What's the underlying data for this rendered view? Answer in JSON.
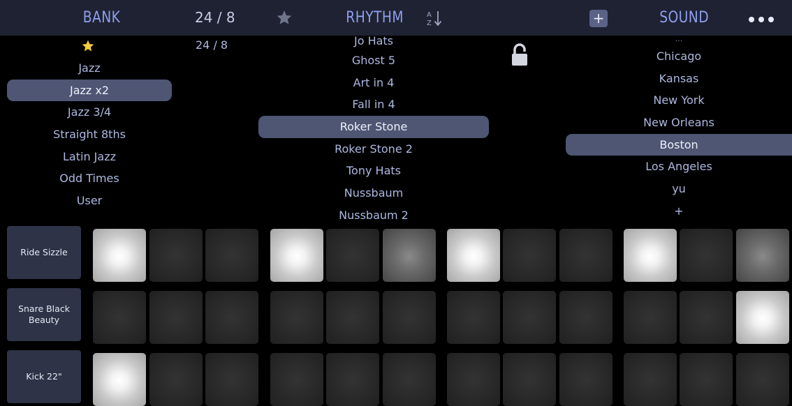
{
  "header": {
    "bank_title": "BANK",
    "time_sig": "24 / 8",
    "rhythm_title": "RHYTHM",
    "sort_icon": "sort-a-z-icon",
    "plus_label": "+",
    "sound_title": "SOUND",
    "menu_icon": "more-dots-icon"
  },
  "bank": {
    "items": [
      "Jazz",
      "Jazz x2",
      "Jazz 3/4",
      "Straight 8ths",
      "Latin Jazz",
      "Odd Times",
      "User"
    ],
    "selected": "Jazz x2"
  },
  "time_signature_list": {
    "value": "24 / 8"
  },
  "rhythm": {
    "items": [
      "Jo Hats",
      "Ghost 5",
      "Art in 4",
      "Fall in 4",
      "Roker Stone",
      "Roker Stone 2",
      "Tony Hats",
      "Nussbaum",
      "Nussbaum 2"
    ],
    "selected": "Roker Stone",
    "lock_icon": "lock-icon"
  },
  "sound": {
    "ellipsis": "...",
    "items": [
      "Chicago",
      "Kansas",
      "New York",
      "New Orleans",
      "Boston",
      "Los Angeles",
      "yu",
      "+"
    ],
    "selected": "Boston"
  },
  "sequencer": {
    "rows": [
      {
        "label": "Ride Sizzle",
        "steps": [
          1,
          0,
          0,
          1,
          0,
          0.5,
          1,
          0,
          0,
          1,
          0,
          0.5
        ]
      },
      {
        "label": "Snare Black Beauty",
        "steps": [
          0,
          0,
          0,
          0,
          0,
          0,
          0,
          0,
          0,
          0,
          0,
          1
        ]
      },
      {
        "label": "Kick 22\"",
        "steps": [
          1,
          0,
          0,
          0,
          0,
          0,
          0,
          0,
          0,
          0,
          0,
          0
        ]
      }
    ]
  },
  "colors": {
    "header_bg": "#1f2233",
    "title_accent": "#8f9fec",
    "selection": "#4e5674",
    "star": "#f5cc3a"
  }
}
